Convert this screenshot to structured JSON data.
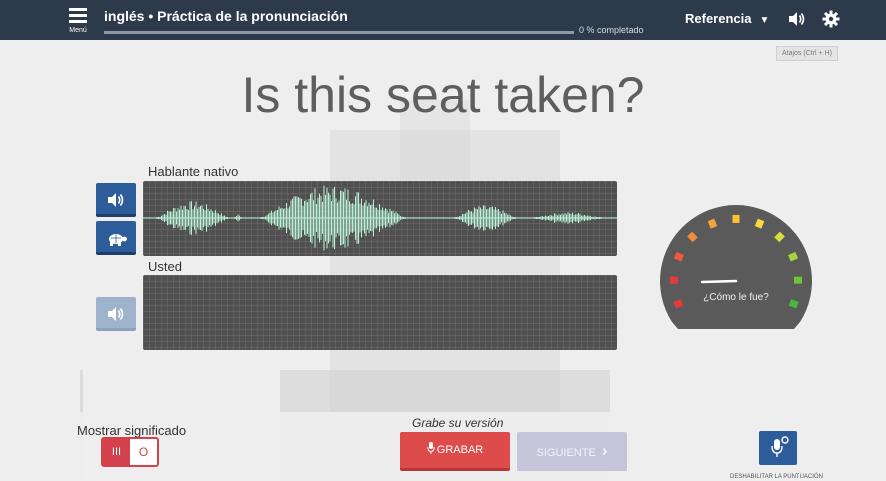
{
  "header": {
    "menu_label": "Menú",
    "title": "inglés • Práctica de la pronunciación",
    "progress_percent": 0,
    "progress_text": "0 % completado",
    "reference_label": "Referencia",
    "speaker_icon": "speaker-icon",
    "settings_icon": "gear-icon"
  },
  "shortcut_hint": "Atajos (Ctrl + H)",
  "phrase": "Is this seat taken?",
  "native": {
    "label": "Hablante nativo",
    "play_icon": "speaker-icon",
    "slow_icon": "turtle-icon",
    "waveform_color": "#b9f0d6"
  },
  "user": {
    "label": "Usted",
    "play_icon": "speaker-icon"
  },
  "gauge": {
    "question": "¿Cómo le fue?",
    "colors": [
      "#e8393e",
      "#e8393e",
      "#ee5a3c",
      "#f28b3a",
      "#f5a33a",
      "#f7c233",
      "#f9d93c",
      "#d9de3c",
      "#a6d33e",
      "#6fc43f",
      "#4ab541"
    ]
  },
  "bottom": {
    "show_meaning_label": "Mostrar significado",
    "toggle_on": "III",
    "toggle_off": "O",
    "record_hint": "Grabe su versión",
    "record_label": "GRABAR",
    "next_label": "SIGUIENTE",
    "disable_scoring_label": "DESHABILITAR LA PUNTUACIÓN"
  },
  "colors": {
    "topbar": "#2d3a4b",
    "accent_blue": "#2c5c99",
    "record_red": "#dd4b4b",
    "next_disabled": "#c6c4d9"
  }
}
